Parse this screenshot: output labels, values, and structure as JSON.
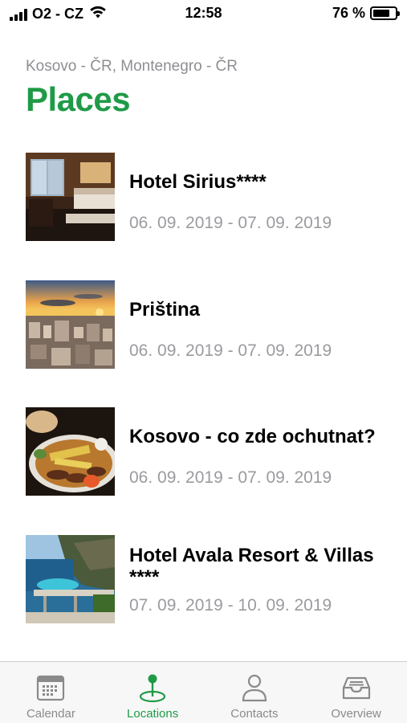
{
  "status_bar": {
    "carrier": "O2 - CZ",
    "time": "12:58",
    "battery": "76 %",
    "battery_level": 0.76
  },
  "header": {
    "subtitle": "Kosovo - ČR, Montenegro - ČR",
    "title": "Places"
  },
  "places": [
    {
      "name": "Hotel Sirius****",
      "dates": "06. 09. 2019 - 07. 09. 2019",
      "image": "hotel-room-photo"
    },
    {
      "name": "Priština",
      "dates": "06. 09. 2019 - 07. 09. 2019",
      "image": "city-sunset-photo"
    },
    {
      "name": "Kosovo - co zde ochutnat?",
      "dates": "06. 09. 2019 - 07. 09. 2019",
      "image": "food-platter-photo"
    },
    {
      "name_line1": "Hotel Avala Resort & Villas",
      "name_line2": "****",
      "dates": "07. 09. 2019 - 10. 09. 2019",
      "image": "seaside-resort-photo"
    }
  ],
  "tabs": [
    {
      "label": "Calendar",
      "icon": "calendar-icon",
      "active": false
    },
    {
      "label": "Locations",
      "icon": "location-pin-icon",
      "active": true
    },
    {
      "label": "Contacts",
      "icon": "person-icon",
      "active": false
    },
    {
      "label": "Overview",
      "icon": "inbox-tray-icon",
      "active": false
    }
  ],
  "colors": {
    "accent": "#1f9a47",
    "secondary_text": "#9b9ba0",
    "tab_inactive": "#8a8a8a",
    "tab_bar_bg": "#f7f7f7"
  }
}
